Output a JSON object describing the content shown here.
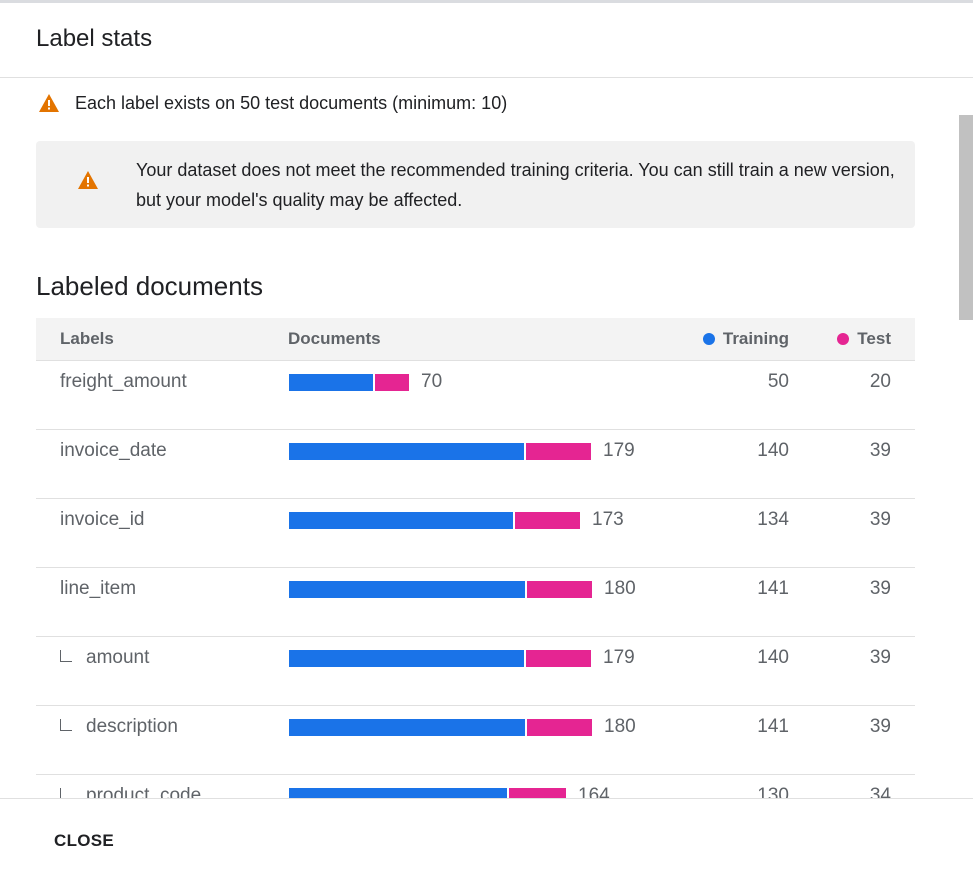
{
  "dialog": {
    "title": "Label stats",
    "warning_text": "Each label exists on 50 test documents (minimum: 10)",
    "banner_text": "Your dataset does not meet the recommended training criteria. You can still train a new version, but your model's quality may be affected.",
    "section_title": "Labeled documents",
    "close_label": "CLOSE"
  },
  "colors": {
    "training": "#1a73e8",
    "test": "#e52592",
    "warning": "#e37400"
  },
  "table": {
    "headers": {
      "labels": "Labels",
      "documents": "Documents",
      "training": "Training",
      "test": "Test"
    },
    "rows": [
      {
        "label": "freight_amount",
        "total": "70",
        "training": "50",
        "test": "20",
        "sub": false
      },
      {
        "label": "invoice_date",
        "total": "179",
        "training": "140",
        "test": "39",
        "sub": false
      },
      {
        "label": "invoice_id",
        "total": "173",
        "training": "134",
        "test": "39",
        "sub": false
      },
      {
        "label": "line_item",
        "total": "180",
        "training": "141",
        "test": "39",
        "sub": false
      },
      {
        "label": "amount",
        "total": "179",
        "training": "140",
        "test": "39",
        "sub": true
      },
      {
        "label": "description",
        "total": "180",
        "training": "141",
        "test": "39",
        "sub": true
      },
      {
        "label": "product_code",
        "total": "164",
        "training": "130",
        "test": "34",
        "sub": true
      }
    ]
  }
}
